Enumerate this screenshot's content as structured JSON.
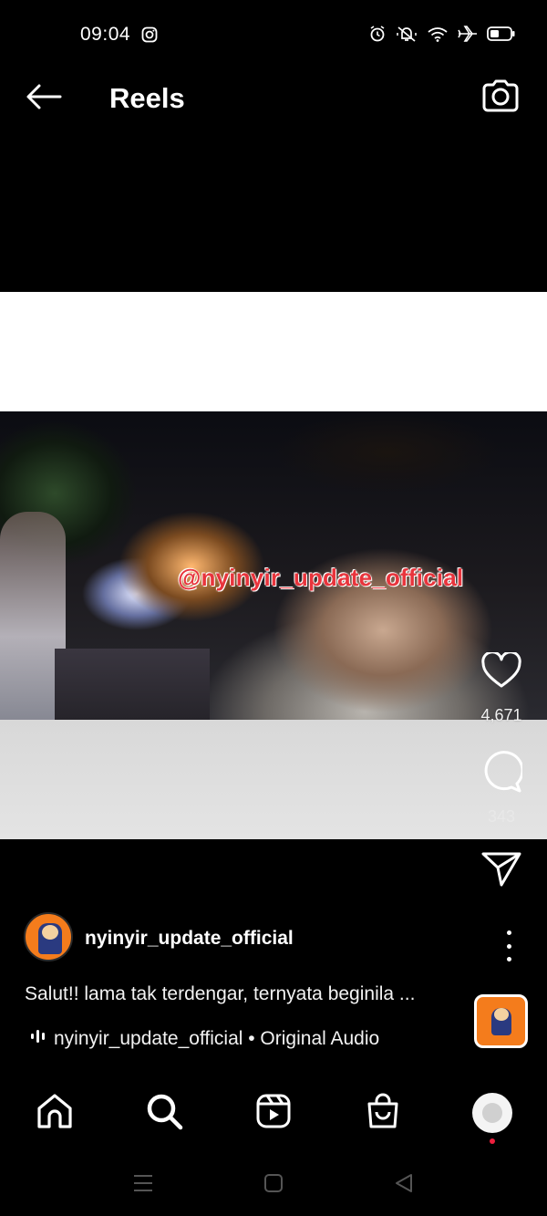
{
  "status_bar": {
    "time": "09:04"
  },
  "header": {
    "title": "Reels"
  },
  "reel": {
    "watermark": "@nyinyir_update_official"
  },
  "actions": {
    "like_count": "4,671",
    "comment_count": "343"
  },
  "owner": {
    "username": "nyinyir_update_official"
  },
  "caption": "Salut!! lama tak terdengar, ternyata beginila ...",
  "audio": {
    "label": "nyinyir_update_official • Original Audio"
  },
  "colors": {
    "background": "#000000",
    "notification_dot": "#ed1f3d",
    "watermark": "#e8343c",
    "avatar_bg": "#f47c1c"
  },
  "icons": {
    "status": [
      "instagram-icon",
      "alarm-icon",
      "mute-icon",
      "wifi-icon",
      "airplane-icon",
      "battery-icon"
    ],
    "header": [
      "back-arrow-icon",
      "camera-icon"
    ],
    "actions": [
      "heart-icon",
      "comment-icon",
      "send-icon"
    ],
    "nav": [
      "home-icon",
      "search-icon",
      "reels-icon",
      "shop-icon",
      "profile-icon"
    ],
    "system": [
      "menu-icon",
      "home-square-icon",
      "back-triangle-icon"
    ]
  }
}
